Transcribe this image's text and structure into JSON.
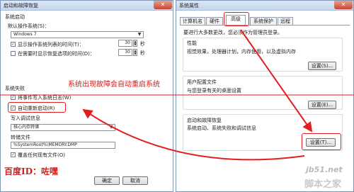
{
  "left": {
    "title": "启动和故障恢复",
    "system_startup": "系统启动",
    "default_os_label": "默认操作系统(S)：",
    "default_os_value": "Windows 7",
    "show_os_list": "显示操作系统列表的时间(T)：",
    "show_os_list_value": "30",
    "show_recovery": "在需要时显示恢复选项的时间(D)：",
    "show_recovery_value": "30",
    "seconds": "秒",
    "system_failure": "系统失败",
    "write_event": "将事件写入系统日志(W)",
    "auto_restart": "自动重新启动(R)",
    "debug_info": "写入调试信息",
    "debug_option": "核心内存转储",
    "dump_file_label": "转储文件",
    "dump_file_value": "%SystemRoot%\\MEMORY.DMP",
    "overwrite": "覆盖任何现有文件(O)",
    "ok": "确定",
    "cancel": "取消"
  },
  "right": {
    "title": "系统属性",
    "tabs": [
      "计算机名",
      "硬件",
      "高级",
      "系统保护",
      "远程"
    ],
    "admin_note": "要进行大多数更改，您必须作为管理员登录。",
    "performance_title": "性能",
    "performance_desc": "视觉效果，处理器计划，内存使用，以及虚拟内存",
    "profiles_title": "用户配置文件",
    "profiles_desc": "与您登录有关的桌面设置",
    "startup_title": "启动和故障恢复",
    "startup_desc": "系统启动、系统失败和调试信息",
    "settings_s": "设置(S)...",
    "settings_e": "设置(E)...",
    "settings_t": "设置(T)..."
  },
  "annotations": {
    "restart_note": "系统出现故障会自动重启系统",
    "baidu_id": "百度ID：咗嘿",
    "watermark_site": "jb51.net",
    "watermark_name": "脚本之家"
  },
  "colors": {
    "annotation_red": "#d51b18",
    "highlight_red": "#e31d1d"
  }
}
